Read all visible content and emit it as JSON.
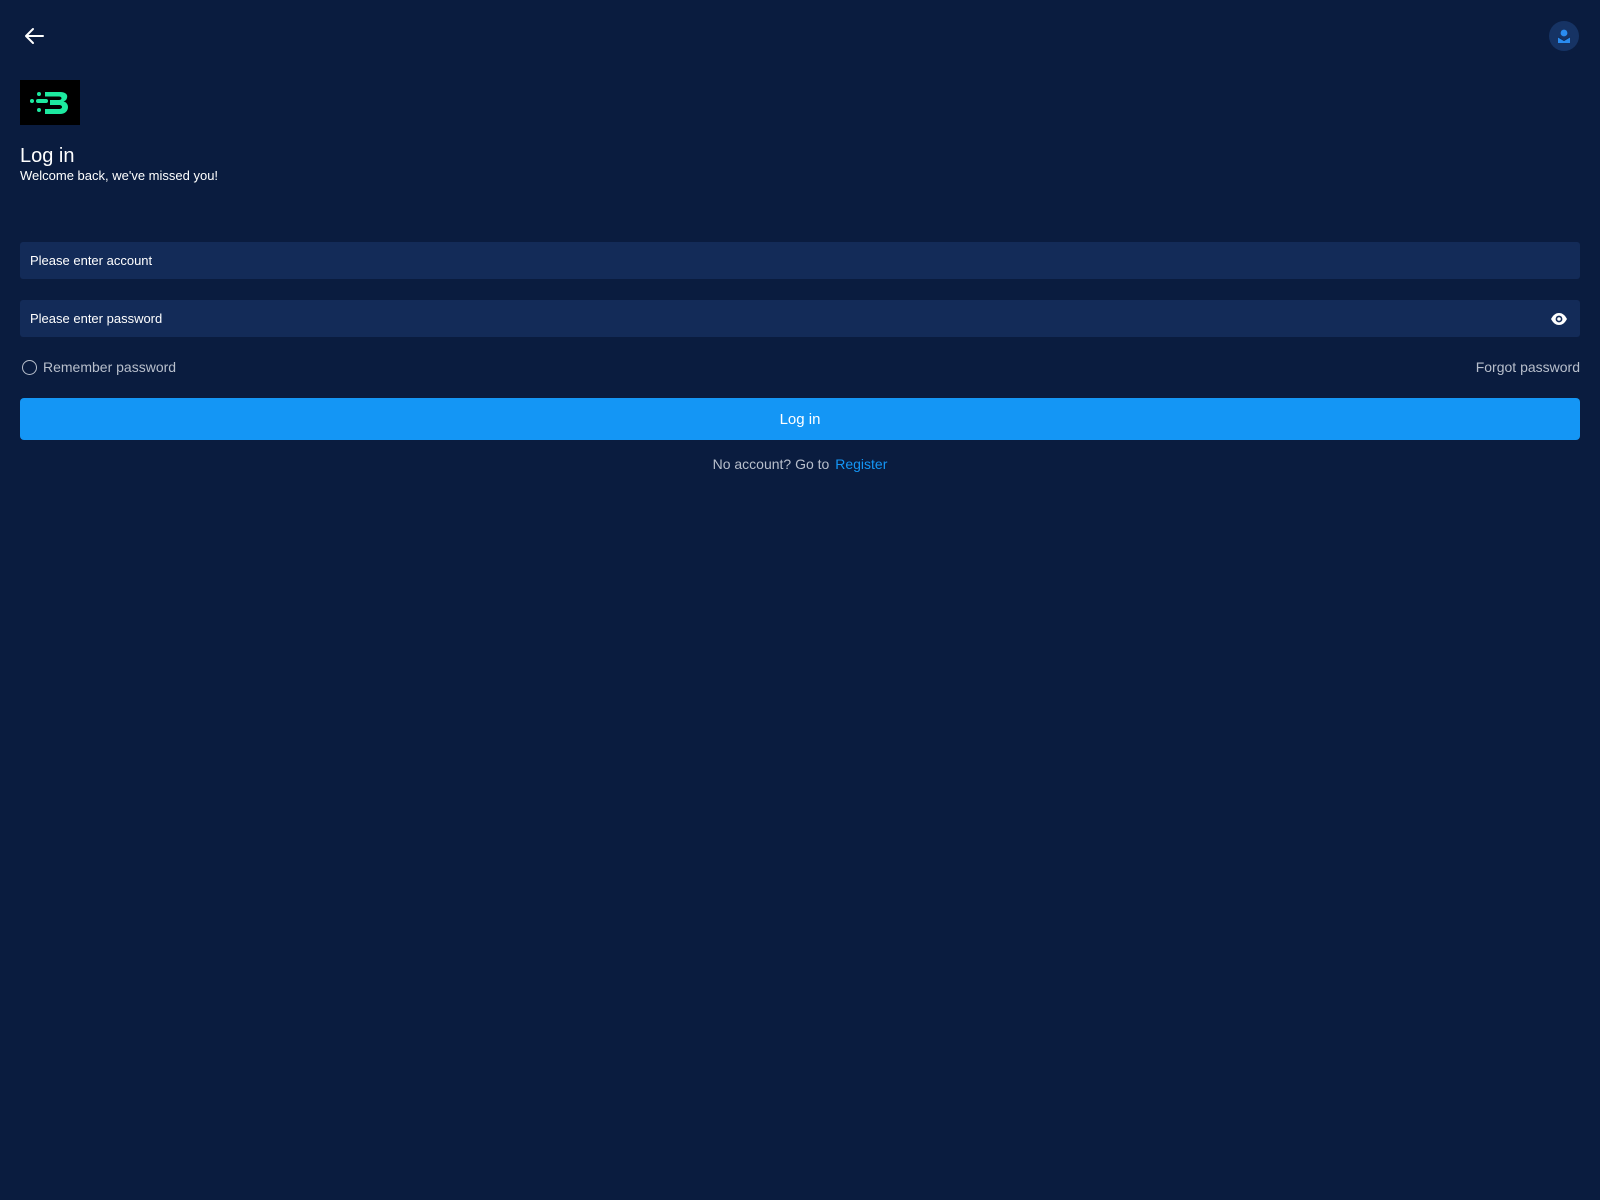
{
  "header": {
    "back_icon": "arrow-left-icon",
    "support_icon": "support-agent-icon"
  },
  "brand": {
    "logo_icon": "speed-b-logo",
    "logo_color": "#1de9a0"
  },
  "login": {
    "title": "Log in",
    "subtitle": "Welcome back, we've missed you!",
    "account_placeholder": "Please enter account",
    "password_placeholder": "Please enter password",
    "password_toggle_icon": "eye-icon",
    "remember_label": "Remember password",
    "remember_checked": false,
    "forgot_label": "Forgot password",
    "submit_label": "Log in",
    "no_account_text": "No account?  Go to",
    "register_label": "Register"
  },
  "colors": {
    "background": "#0a1c3f",
    "field_background": "#132b58",
    "accent": "#1496f5",
    "muted_text": "#b8bfcc"
  }
}
